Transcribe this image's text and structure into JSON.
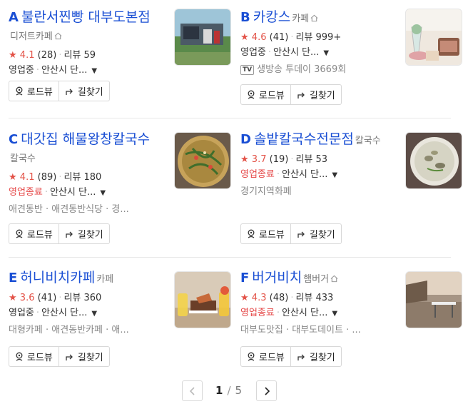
{
  "places": [
    {
      "letter": "A",
      "name": "불란서찐빵 대부도본점",
      "category": "디저트카페",
      "home_icon": true,
      "rating": "4.1",
      "rating_count": "(28)",
      "review_label": "리뷰 59",
      "status": "영업중",
      "status_type": "open",
      "location": "안산시 단...",
      "extra": ""
    },
    {
      "letter": "B",
      "name": "카캉스",
      "category": "카페",
      "home_icon": true,
      "rating": "4.6",
      "rating_count": "(41)",
      "review_label": "리뷰 999+",
      "status": "영업중",
      "status_type": "open",
      "location": "안산시 단...",
      "extra": "생방송 투데이 3669회",
      "tv_badge": "TV"
    },
    {
      "letter": "C",
      "name": "대갓집 해물왕창칼국수",
      "category": "칼국수",
      "home_icon": false,
      "rating": "4.1",
      "rating_count": "(89)",
      "review_label": "리뷰 180",
      "status": "영업종료",
      "status_type": "closed",
      "location": "안산시 단...",
      "extra": "애견동반 · 애견동반식당 · 경..."
    },
    {
      "letter": "D",
      "name": "솔밭칼국수전문점",
      "category": "칼국수",
      "home_icon": false,
      "rating": "3.7",
      "rating_count": "(19)",
      "review_label": "리뷰 53",
      "status": "영업종료",
      "status_type": "closed",
      "location": "안산시 단...",
      "extra": "경기지역화폐"
    },
    {
      "letter": "E",
      "name": "허니비치카페",
      "category": "카페",
      "home_icon": false,
      "rating": "3.6",
      "rating_count": "(41)",
      "review_label": "리뷰 360",
      "status": "영업중",
      "status_type": "open",
      "location": "안산시 단...",
      "extra": "대형카페 · 애견동반카페 · 애..."
    },
    {
      "letter": "F",
      "name": "버거비치",
      "category": "햄버거",
      "home_icon": true,
      "rating": "4.3",
      "rating_count": "(48)",
      "review_label": "리뷰 433",
      "status": "영업종료",
      "status_type": "closed",
      "location": "안산시 단...",
      "extra": "대부도맛집 · 대부도데이트 · ..."
    }
  ],
  "buttons": {
    "roadview": "로드뷰",
    "directions": "길찾기"
  },
  "pagination": {
    "current": "1",
    "separator": "/",
    "total": "5"
  },
  "colors": {
    "link": "#1a4fd4",
    "star": "#e35247",
    "closed": "#e54545"
  }
}
